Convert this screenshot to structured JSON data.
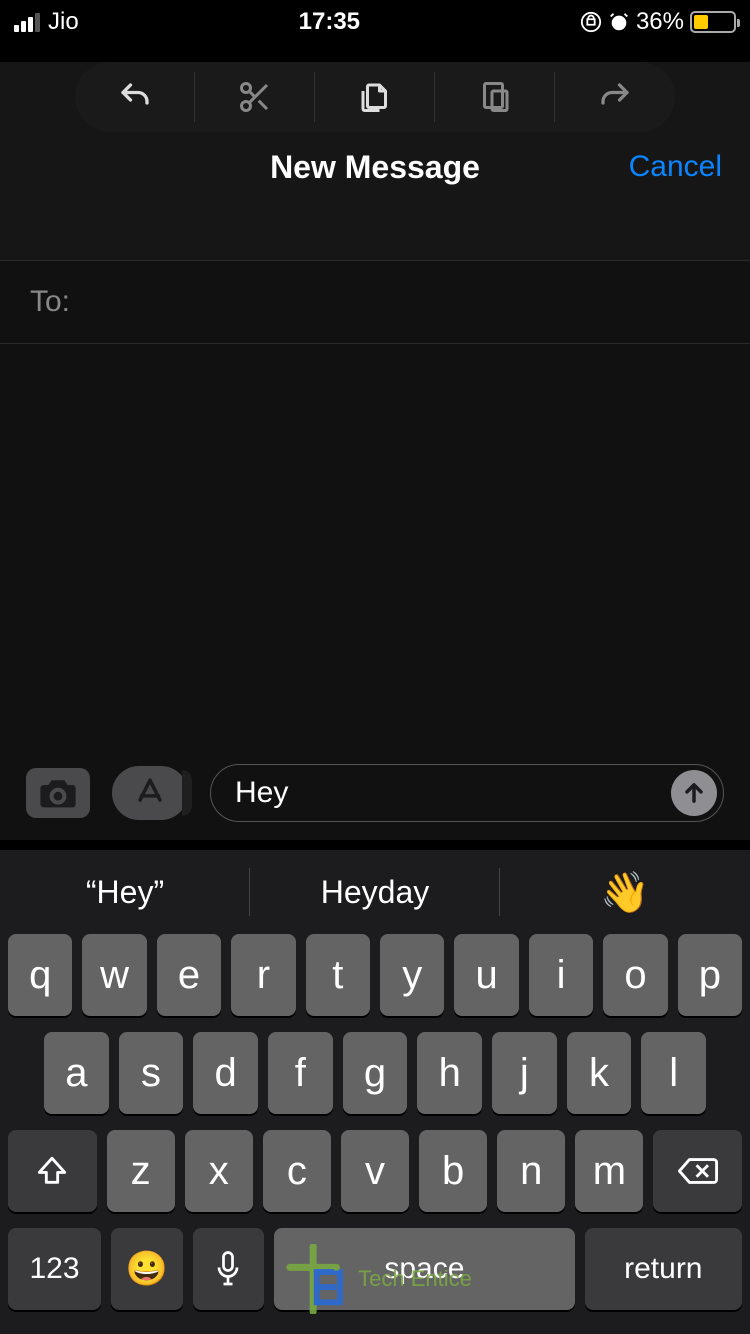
{
  "status": {
    "carrier": "Jio",
    "time": "17:35",
    "battery_pct": "36%"
  },
  "toolbar": {
    "undo": "undo",
    "cut": "cut",
    "copy": "copy",
    "paste": "paste",
    "redo": "redo"
  },
  "header": {
    "title": "New Message",
    "cancel": "Cancel"
  },
  "compose": {
    "to_label": "To:",
    "input_value": "Hey"
  },
  "suggestions": [
    "“Hey”",
    "Heyday",
    "👋"
  ],
  "keyboard": {
    "row1": [
      "q",
      "w",
      "e",
      "r",
      "t",
      "y",
      "u",
      "i",
      "o",
      "p"
    ],
    "row2": [
      "a",
      "s",
      "d",
      "f",
      "g",
      "h",
      "j",
      "k",
      "l"
    ],
    "row3": [
      "z",
      "x",
      "c",
      "v",
      "b",
      "n",
      "m"
    ],
    "numbers": "123",
    "space": "space",
    "return": "return"
  },
  "watermark": "Tech Entice"
}
